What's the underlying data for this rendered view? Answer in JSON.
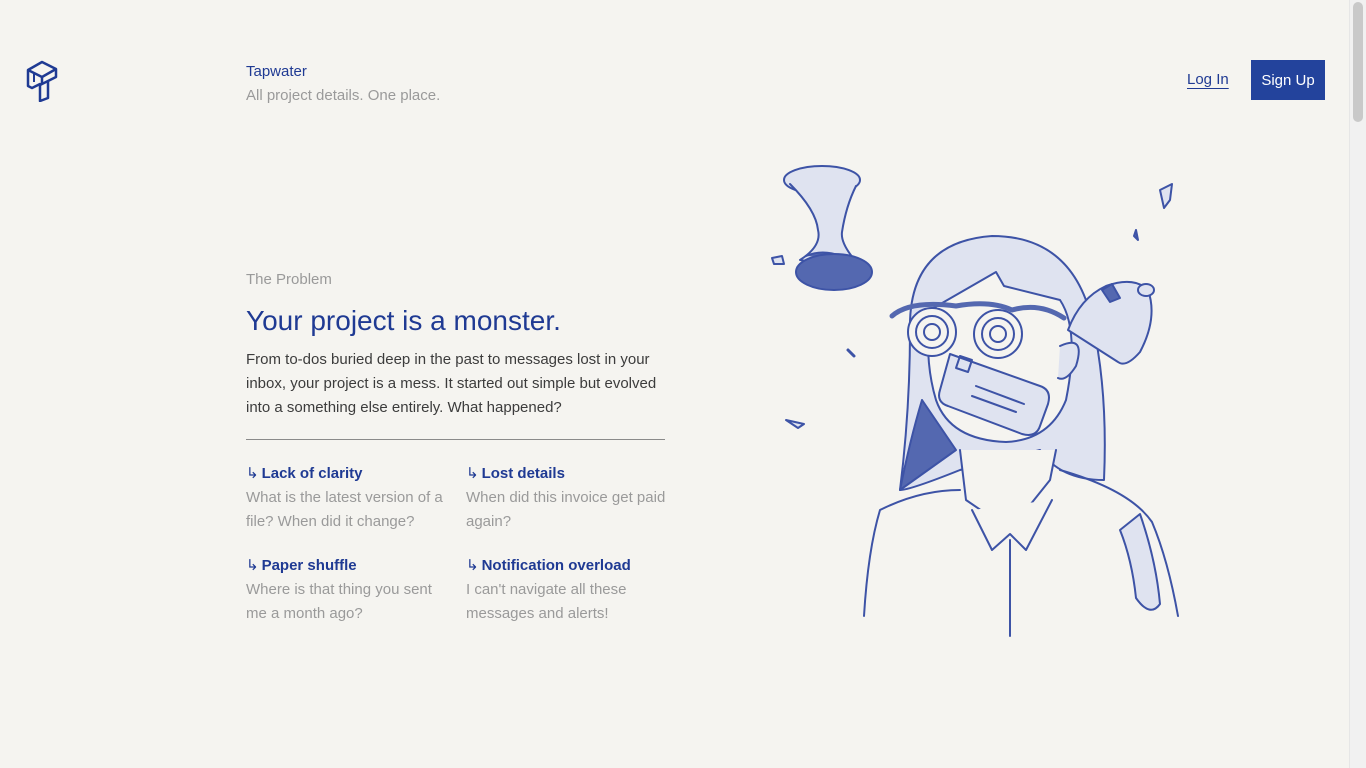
{
  "header": {
    "brand_name": "Tapwater",
    "tagline": "All project details. One place.",
    "login_label": "Log In",
    "signup_label": "Sign Up"
  },
  "hero": {
    "eyebrow": "The Problem",
    "headline": "Your project is a monster.",
    "body": "From to-dos buried deep in the past to messages lost in your inbox, your project is a mess. It started out simple but evolved into a something else entirely. What happened?"
  },
  "problems": [
    {
      "arrow": "↳",
      "title": "Lack of clarity",
      "desc": "What is the latest version of a file? When did it change?"
    },
    {
      "arrow": "↳",
      "title": "Lost details",
      "desc": "When did this invoice get paid again?"
    },
    {
      "arrow": "↳",
      "title": "Paper shuffle",
      "desc": "Where is that thing you sent me a month ago?"
    },
    {
      "arrow": "↳",
      "title": "Notification overload",
      "desc": "I can't navigate all these messages and alerts!"
    }
  ],
  "colors": {
    "brand_blue": "#1f3a93",
    "button_blue": "#23439c",
    "illustration_fill": "#dfe3f0",
    "illustration_dark": "#5468b0",
    "background": "#f5f4f0"
  },
  "icons": {
    "logo": "tapwater-logo-icon",
    "arrow": "return-arrow-icon"
  }
}
